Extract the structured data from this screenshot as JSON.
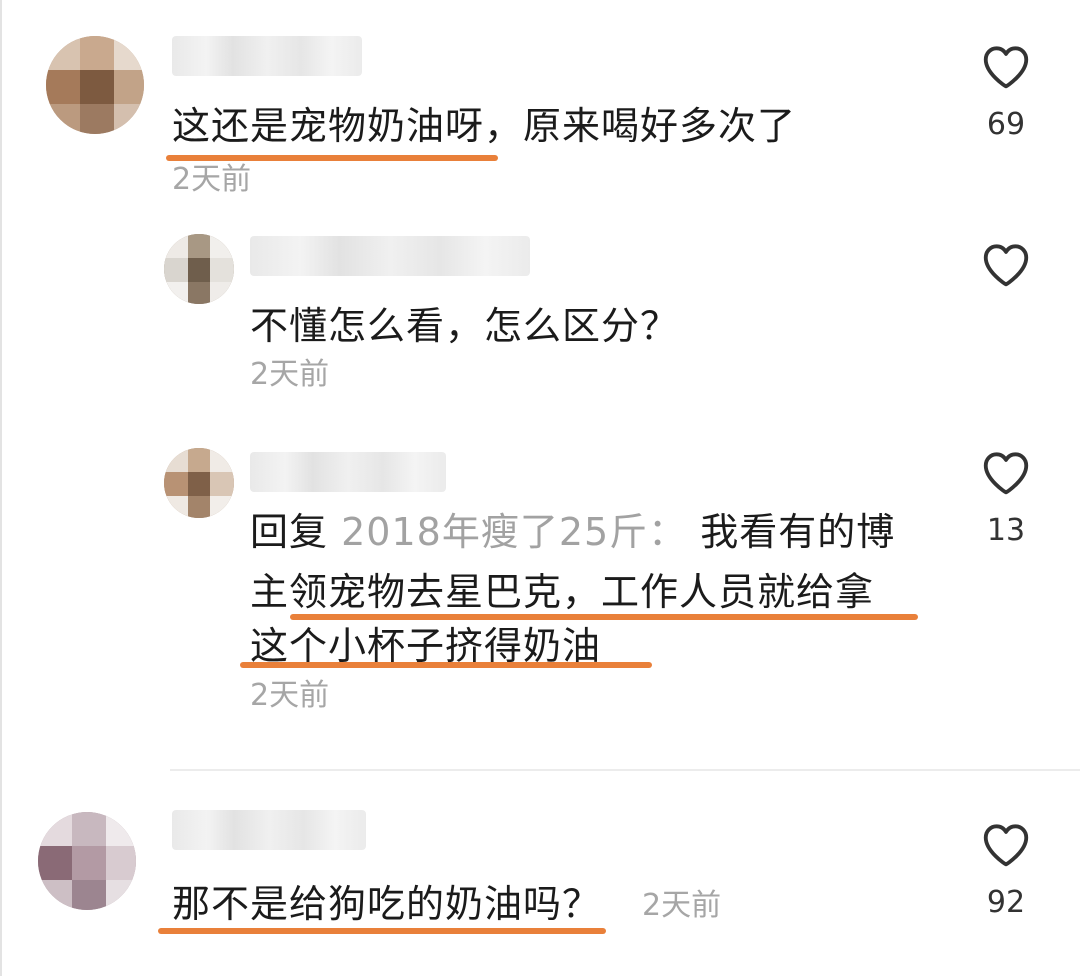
{
  "comments": [
    {
      "text": "这还是宠物奶油呀，原来喝好多次了",
      "time": "2天前",
      "likes": "69",
      "username_blurred": true
    },
    {
      "text": "不懂怎么看，怎么区分？",
      "time": "2天前",
      "likes": "",
      "username_blurred": true
    },
    {
      "reply_prefix": "回复",
      "reply_to": "2018年瘦了25斤：",
      "line1": "我看有的博",
      "line2": "主领宠物去星巴克，工作人员就给拿",
      "line3": "这个小杯子挤得奶油",
      "time": "2天前",
      "likes": "13",
      "username_blurred": true
    },
    {
      "text": "那不是给狗吃的奶油吗？",
      "time": "2天前",
      "likes": "92",
      "username_blurred": true
    }
  ],
  "colors": {
    "underline": "#e9803a",
    "time_text": "#a6a6a6",
    "body_text": "#1b1b1b",
    "divider": "#ececec"
  },
  "icons": {
    "like": "heart-outline-icon"
  }
}
